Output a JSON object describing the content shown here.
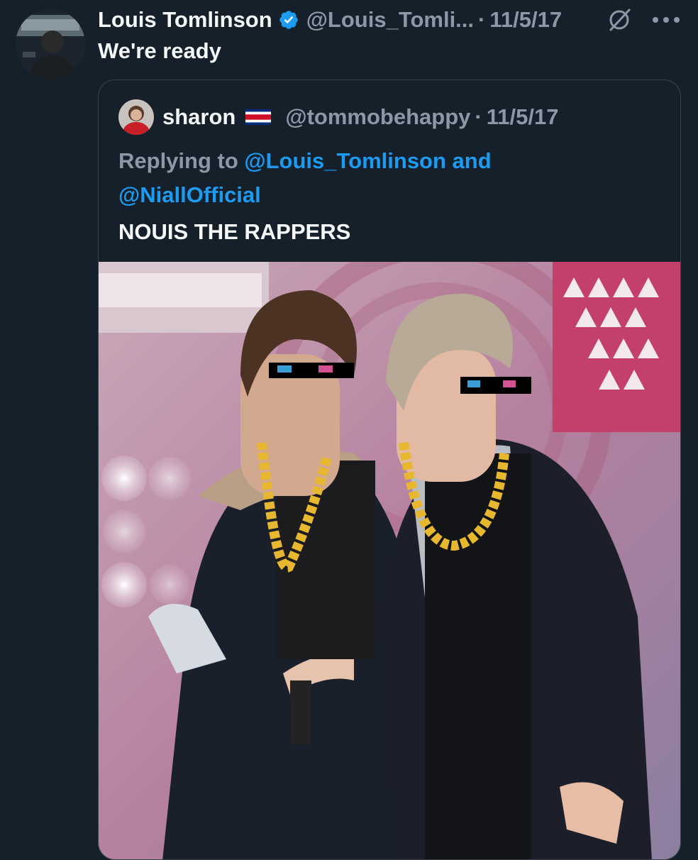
{
  "tweet": {
    "display_name": "Louis Tomlinson",
    "handle": "@Louis_Tomli...",
    "separator": "·",
    "date": "11/5/17",
    "text": "We're ready",
    "avatar_icon": "user-avatar-photo",
    "verified_icon": "verified-badge-icon",
    "grok_icon": "grok-icon",
    "more_icon": "more-options-icon"
  },
  "quoted_tweet": {
    "display_name": "sharon",
    "flag_icon": "costa-rica-flag-icon",
    "handle": "@tommobehappy",
    "separator": "·",
    "date": "11/5/17",
    "reply_prefix": "Replying to ",
    "reply_mention_1": "@Louis_Tomlinson",
    "reply_and": " and",
    "reply_mention_2": "@NiallOfficial",
    "text": "NOUIS THE RAPPERS",
    "image_icon": "meme-photo"
  },
  "colors": {
    "background": "#15202b",
    "text_primary": "#f7f9f9",
    "text_secondary": "#8b98a5",
    "accent": "#1d9bf0",
    "border": "#38444d"
  }
}
